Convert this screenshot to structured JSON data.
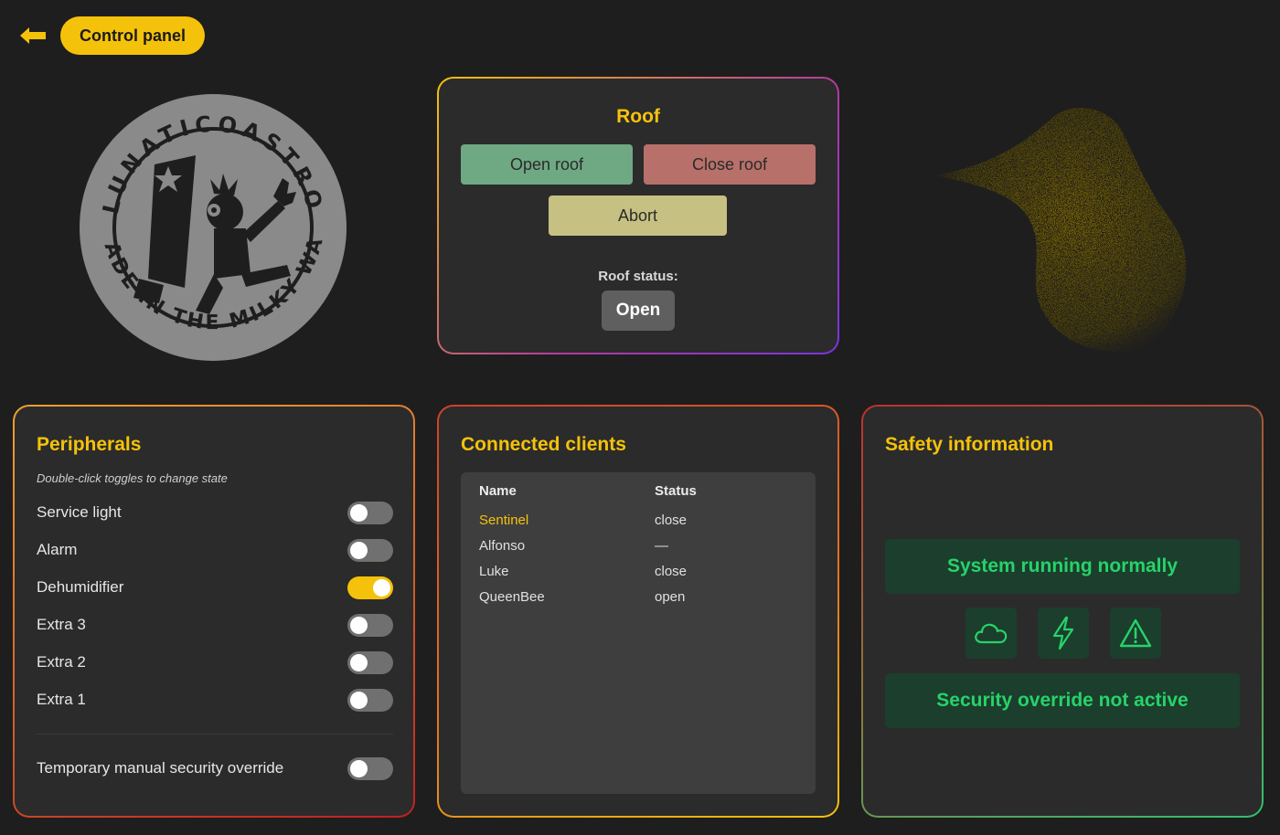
{
  "header": {
    "title": "Control panel",
    "back_icon": "arrow-left-icon"
  },
  "logo": {
    "text_top": "LUNATICOASTRO",
    "text_bottom": "MADE IN THE MILKY WAY"
  },
  "roof": {
    "title": "Roof",
    "open_label": "Open roof",
    "close_label": "Close roof",
    "abort_label": "Abort",
    "status_label": "Roof status:",
    "status_value": "Open"
  },
  "peripherals": {
    "title": "Peripherals",
    "subtitle": "Double-click toggles to change state",
    "items": [
      {
        "label": "Service light",
        "on": false
      },
      {
        "label": "Alarm",
        "on": false
      },
      {
        "label": "Dehumidifier",
        "on": true
      },
      {
        "label": "Extra 3",
        "on": false
      },
      {
        "label": "Extra 2",
        "on": false
      },
      {
        "label": "Extra 1",
        "on": false
      }
    ],
    "override": {
      "label": "Temporary manual security override",
      "on": false
    }
  },
  "clients": {
    "title": "Connected clients",
    "columns": [
      "Name",
      "Status"
    ],
    "rows": [
      {
        "name": "Sentinel",
        "status": "close",
        "highlight": true
      },
      {
        "name": "Alfonso",
        "status": "—",
        "highlight": false
      },
      {
        "name": "Luke",
        "status": "close",
        "highlight": false
      },
      {
        "name": "QueenBee",
        "status": "open",
        "highlight": false
      }
    ]
  },
  "safety": {
    "title": "Safety information",
    "system_status": "System running normally",
    "override_status": "Security override not active",
    "icons": [
      "cloud-icon",
      "lightning-icon",
      "warning-icon"
    ]
  },
  "colors": {
    "accent": "#f5c20b",
    "ok_green": "#26d36a",
    "ok_bg": "#1c3e2d",
    "open_roof": "#6fa983",
    "close_roof": "#b8706a",
    "abort": "#c6c083"
  }
}
